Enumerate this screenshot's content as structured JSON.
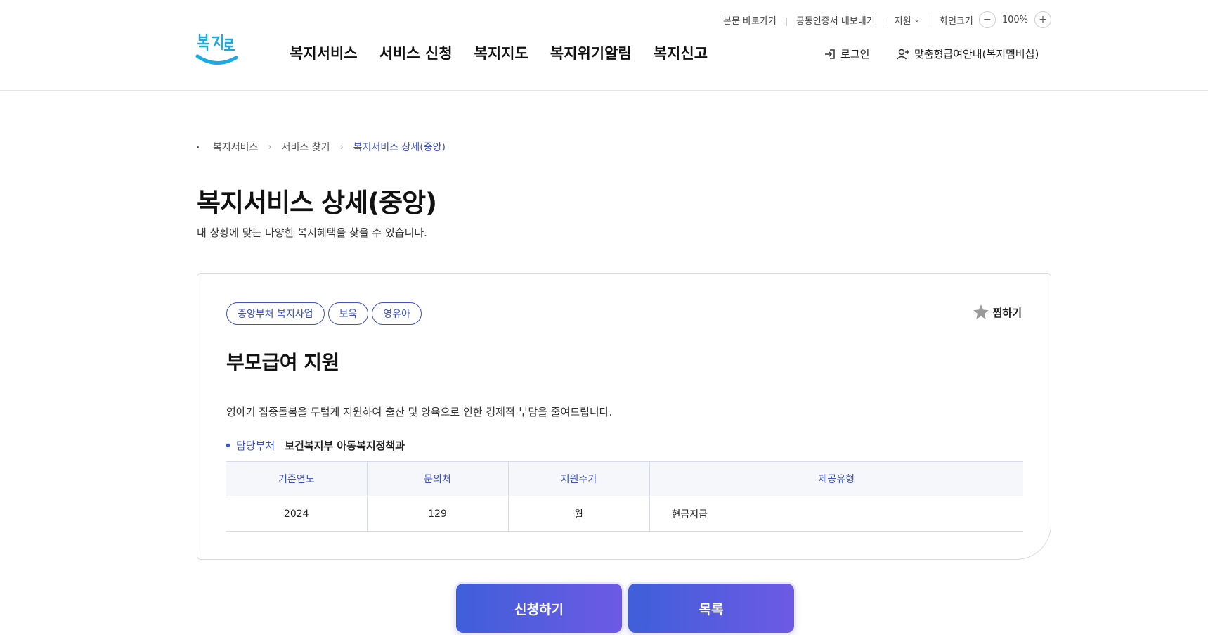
{
  "utility": {
    "skip_link": "본문 바로가기",
    "cert_export": "공동인증서 내보내기",
    "support": "지원",
    "zoom_label": "화면크기",
    "zoom_value": "100%"
  },
  "header": {
    "logo_text": "복지로",
    "nav": [
      "복지서비스",
      "서비스 신청",
      "복지지도",
      "복지위기알림",
      "복지신고"
    ],
    "login": "로그인",
    "member_guide": "맞춤형급여안내(복지멤버십)"
  },
  "breadcrumb": [
    "복지서비스",
    "서비스 찾기",
    "복지서비스 상세(중앙)"
  ],
  "page": {
    "title": "복지서비스 상세(중앙)",
    "description": "내 상황에 맞는 다양한 복지혜택을 찾을 수 있습니다."
  },
  "service": {
    "tags": [
      "중앙부처 복지사업",
      "보육",
      "영유아"
    ],
    "bookmark": "찜하기",
    "title": "부모급여 지원",
    "summary": "영아기 집중돌봄을 두텁게 지원하여 출산 및 양육으로 인한 경제적 부담을 줄여드립니다.",
    "dept_label": "담당부처",
    "dept_value": "보건복지부 아동복지정책과",
    "table": {
      "headers": [
        "기준연도",
        "문의처",
        "지원주기",
        "제공유형"
      ],
      "row": [
        "2024",
        "129",
        "월",
        "현금지급"
      ]
    }
  },
  "buttons": {
    "apply": "신청하기",
    "list": "목록"
  },
  "colors": {
    "accent": "#3d52c4",
    "logo_blue": "#1aa9e0",
    "button_gradient_start": "#3f5fd9",
    "button_gradient_end": "#6d5ae4"
  }
}
